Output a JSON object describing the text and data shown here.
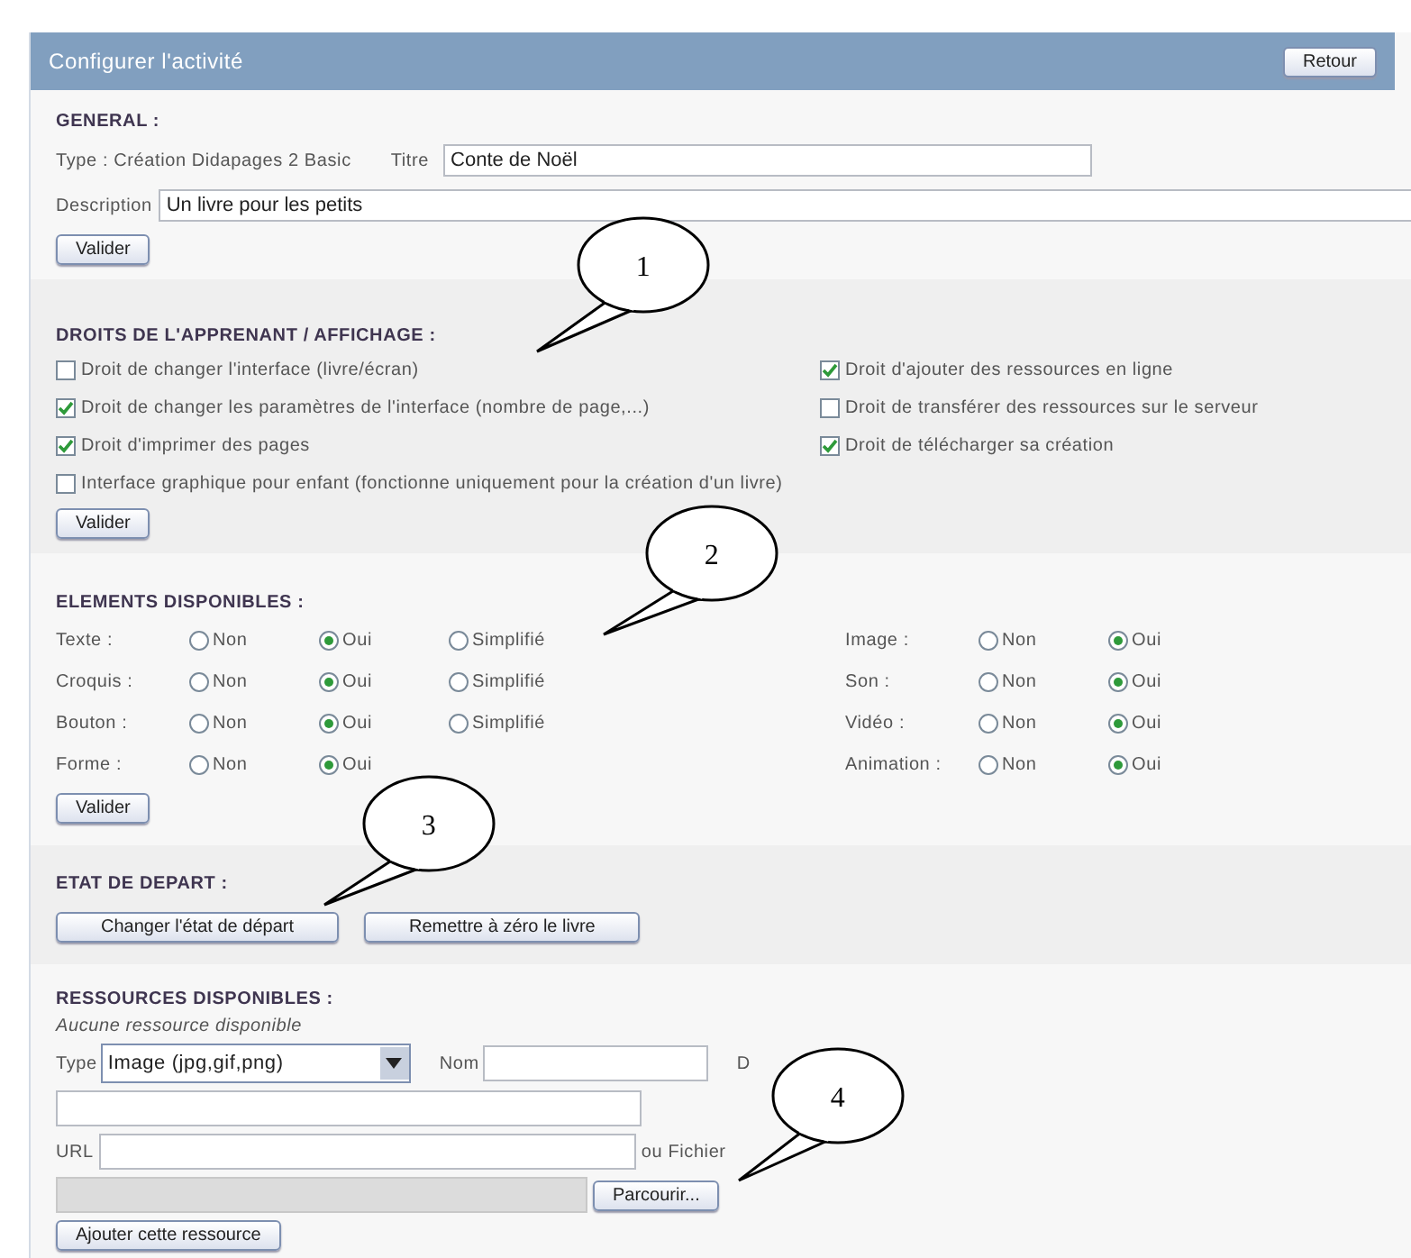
{
  "header": {
    "title": "Configurer l'activité",
    "back_button": "Retour"
  },
  "general": {
    "heading": "GENERAL :",
    "type_text": "Type : Création Didapages 2 Basic",
    "title_label": "Titre",
    "title_value": "Conte de Noël",
    "description_label": "Description",
    "description_value": "Un livre pour les petits",
    "submit": "Valider"
  },
  "rights": {
    "heading": "DROITS DE L'APPRENANT / AFFICHAGE :",
    "options": [
      {
        "label": "Droit de changer l'interface (livre/écran)",
        "checked": false,
        "kind": "half"
      },
      {
        "label": "Droit d'ajouter des ressources en ligne",
        "checked": true,
        "kind": "half"
      },
      {
        "label": "Droit de changer les paramètres de l'interface (nombre de page,...)",
        "checked": true,
        "kind": "half"
      },
      {
        "label": "Droit de transférer des ressources sur le serveur",
        "checked": false,
        "kind": "half"
      },
      {
        "label": "Droit d'imprimer des pages",
        "checked": true,
        "kind": "half"
      },
      {
        "label": "Droit de télécharger sa création",
        "checked": true,
        "kind": "half"
      },
      {
        "label": "Interface graphique pour enfant (fonctionne uniquement pour la création d'un livre)",
        "checked": false,
        "kind": "wide"
      }
    ],
    "submit": "Valider"
  },
  "elements": {
    "heading": "ELEMENTS DISPONIBLES :",
    "groups": [
      {
        "rows": [
          {
            "label": "Texte :",
            "options": [
              {
                "label": "Non",
                "selected": false
              },
              {
                "label": "Oui",
                "selected": true
              },
              {
                "label": "Simplifié",
                "selected": false
              }
            ]
          },
          {
            "label": "Croquis :",
            "options": [
              {
                "label": "Non",
                "selected": false
              },
              {
                "label": "Oui",
                "selected": true
              },
              {
                "label": "Simplifié",
                "selected": false
              }
            ]
          },
          {
            "label": "Bouton :",
            "options": [
              {
                "label": "Non",
                "selected": false
              },
              {
                "label": "Oui",
                "selected": true
              },
              {
                "label": "Simplifié",
                "selected": false
              }
            ]
          },
          {
            "label": "Forme :",
            "options": [
              {
                "label": "Non",
                "selected": false
              },
              {
                "label": "Oui",
                "selected": true
              }
            ]
          }
        ]
      },
      {
        "rows": [
          {
            "label": "Image :",
            "options": [
              {
                "label": "Non",
                "selected": false
              },
              {
                "label": "Oui",
                "selected": true
              }
            ]
          },
          {
            "label": "Son :",
            "options": [
              {
                "label": "Non",
                "selected": false
              },
              {
                "label": "Oui",
                "selected": true
              }
            ]
          },
          {
            "label": "Vidéo :",
            "options": [
              {
                "label": "Non",
                "selected": false
              },
              {
                "label": "Oui",
                "selected": true
              }
            ]
          },
          {
            "label": "Animation :",
            "options": [
              {
                "label": "Non",
                "selected": false
              },
              {
                "label": "Oui",
                "selected": true
              }
            ]
          }
        ]
      }
    ],
    "submit": "Valider"
  },
  "start_state": {
    "heading": "ETAT DE DEPART :",
    "buttons": [
      "Changer l'état de départ",
      "Remettre à zéro le livre"
    ]
  },
  "resources": {
    "heading": "RESSOURCES DISPONIBLES :",
    "note": "Aucune ressource disponible",
    "type_label": "Type",
    "type_value": "Image (jpg,gif,png)",
    "name_label": "Nom",
    "cut_label": "D",
    "url_label": "URL",
    "file_label": "ou Fichier",
    "browse_button": "Parcourir...",
    "add_button": "Ajouter cette ressource"
  },
  "callouts": [
    {
      "label": "1"
    },
    {
      "label": "2"
    },
    {
      "label": "3"
    },
    {
      "label": "4"
    }
  ]
}
